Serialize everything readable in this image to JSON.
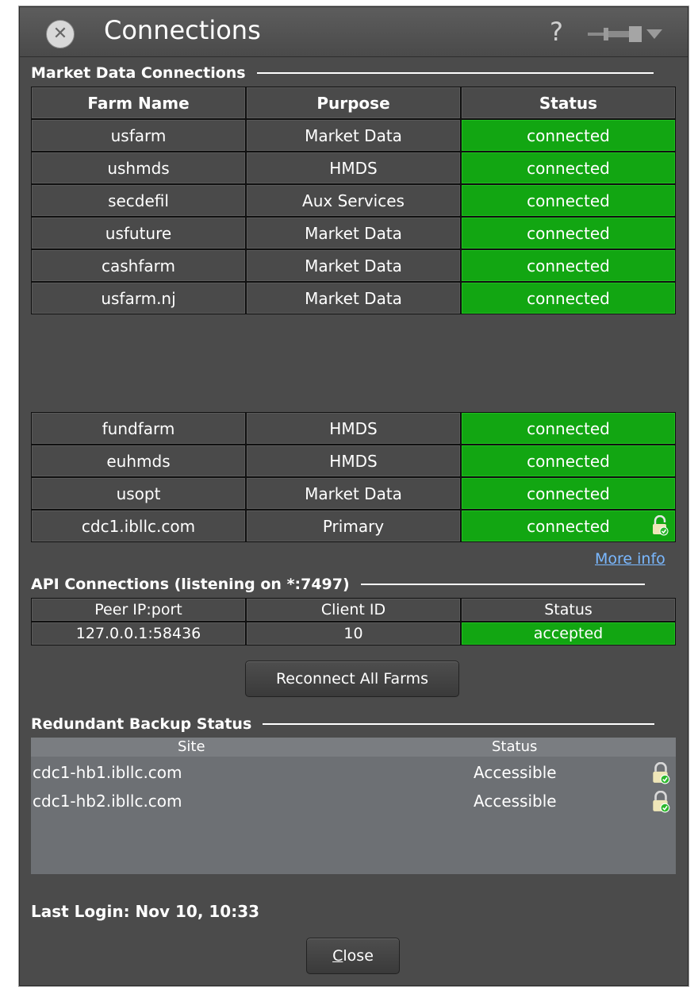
{
  "window": {
    "title": "Connections",
    "help_label": "?"
  },
  "market": {
    "section_title": "Market Data Connections",
    "headers": [
      "Farm Name",
      "Purpose",
      "Status"
    ],
    "rows_top": [
      {
        "farm": "usfarm",
        "purpose": "Market Data",
        "status": "connected"
      },
      {
        "farm": "ushmds",
        "purpose": "HMDS",
        "status": "connected"
      },
      {
        "farm": "secdefil",
        "purpose": "Aux Services",
        "status": "connected"
      },
      {
        "farm": "usfuture",
        "purpose": "Market Data",
        "status": "connected"
      },
      {
        "farm": "cashfarm",
        "purpose": "Market Data",
        "status": "connected"
      },
      {
        "farm": "usfarm.nj",
        "purpose": "Market Data",
        "status": "connected"
      }
    ],
    "rows_bottom": [
      {
        "farm": "fundfarm",
        "purpose": "HMDS",
        "status": "connected"
      },
      {
        "farm": "euhmds",
        "purpose": "HMDS",
        "status": "connected"
      },
      {
        "farm": "usopt",
        "purpose": "Market Data",
        "status": "connected"
      },
      {
        "farm": "cdc1.ibllc.com",
        "purpose": "Primary",
        "status": "connected",
        "secure": true
      }
    ],
    "more_info": "More info"
  },
  "api": {
    "section_title": "API Connections (listening on *:7497)",
    "headers": [
      "Peer IP:port",
      "Client ID",
      "Status"
    ],
    "rows": [
      {
        "peer": "127.0.0.1:58436",
        "client_id": "10",
        "status": "accepted"
      }
    ]
  },
  "buttons": {
    "reconnect": "Reconnect All Farms",
    "close_mnemonic": "C",
    "close_rest": "lose"
  },
  "backup": {
    "section_title": "Redundant Backup Status",
    "headers": [
      "Site",
      "Status"
    ],
    "rows": [
      {
        "site": "cdc1-hb1.ibllc.com",
        "status": "Accessible"
      },
      {
        "site": "cdc1-hb2.ibllc.com",
        "status": "Accessible"
      }
    ]
  },
  "last_login": "Last Login: Nov 10, 10:33",
  "colors": {
    "window_bg": "#4b4b4b",
    "connected": "#12a612",
    "link": "#7ab8ff",
    "backup_bg": "#6d7074"
  }
}
